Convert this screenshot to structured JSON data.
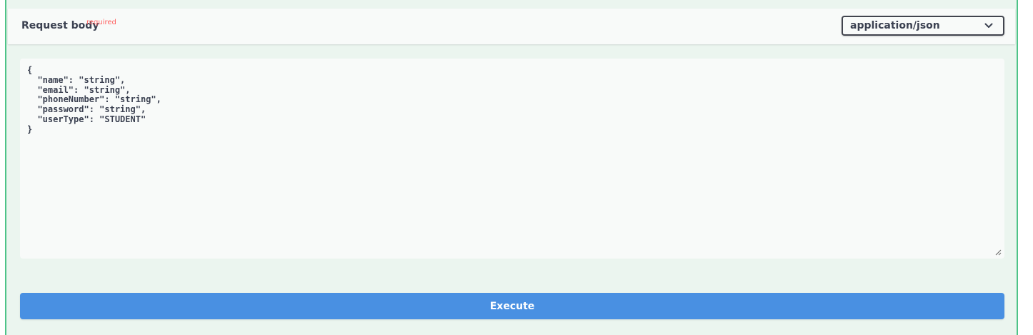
{
  "request_body": {
    "title": "Request body",
    "required_label": "required",
    "content_type": {
      "selected": "application/json",
      "icon": "chevron-down-icon"
    },
    "example_json": "{\n  \"name\": \"string\",\n  \"email\": \"string\",\n  \"phoneNumber\": \"string\",\n  \"password\": \"string\",\n  \"userType\": \"STUDENT\"\n}"
  },
  "execute": {
    "label": "Execute"
  },
  "colors": {
    "panel_background": "#ebf5ef",
    "panel_border": "#4ec388",
    "execute_button": "#4990e2",
    "required": "#ff6060",
    "text": "#3b4151"
  }
}
